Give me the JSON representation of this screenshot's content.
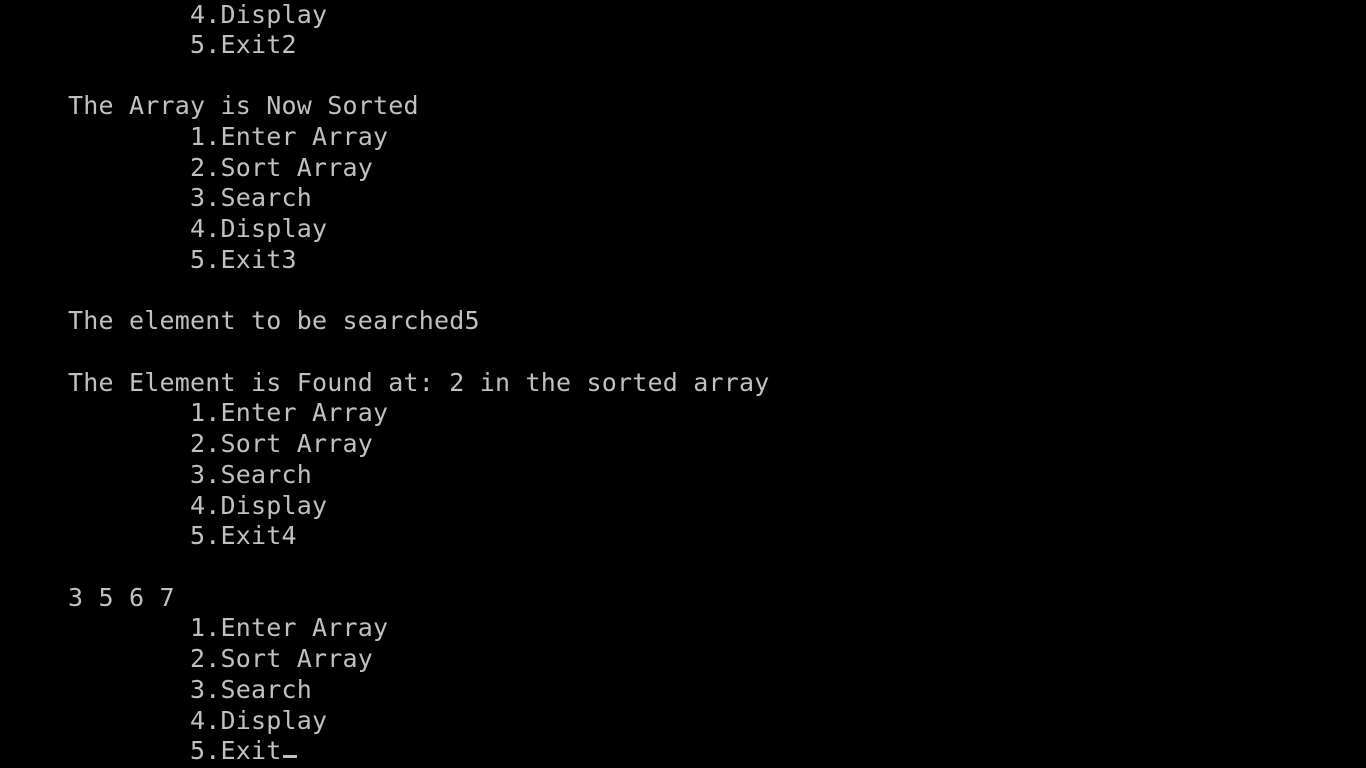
{
  "terminal": {
    "lines": [
      {
        "indent": 1,
        "text": "4.Display"
      },
      {
        "indent": 1,
        "text": "5.Exit2"
      },
      {
        "indent": 0,
        "text": ""
      },
      {
        "indent": 0,
        "text": "The Array is Now Sorted"
      },
      {
        "indent": 1,
        "text": "1.Enter Array"
      },
      {
        "indent": 1,
        "text": "2.Sort Array"
      },
      {
        "indent": 1,
        "text": "3.Search"
      },
      {
        "indent": 1,
        "text": "4.Display"
      },
      {
        "indent": 1,
        "text": "5.Exit3"
      },
      {
        "indent": 0,
        "text": ""
      },
      {
        "indent": 0,
        "text": "The element to be searched5"
      },
      {
        "indent": 0,
        "text": ""
      },
      {
        "indent": 0,
        "text": "The Element is Found at: 2 in the sorted array"
      },
      {
        "indent": 1,
        "text": "1.Enter Array"
      },
      {
        "indent": 1,
        "text": "2.Sort Array"
      },
      {
        "indent": 1,
        "text": "3.Search"
      },
      {
        "indent": 1,
        "text": "4.Display"
      },
      {
        "indent": 1,
        "text": "5.Exit4"
      },
      {
        "indent": 0,
        "text": ""
      },
      {
        "indent": 0,
        "text": "3 5 6 7"
      },
      {
        "indent": 1,
        "text": "1.Enter Array"
      },
      {
        "indent": 1,
        "text": "2.Sort Array"
      },
      {
        "indent": 1,
        "text": "3.Search"
      },
      {
        "indent": 1,
        "text": "4.Display"
      },
      {
        "indent": 1,
        "text": "5.Exit",
        "cursor": true
      }
    ],
    "colors": {
      "background": "#000000",
      "foreground": "#c0c0c0"
    }
  }
}
